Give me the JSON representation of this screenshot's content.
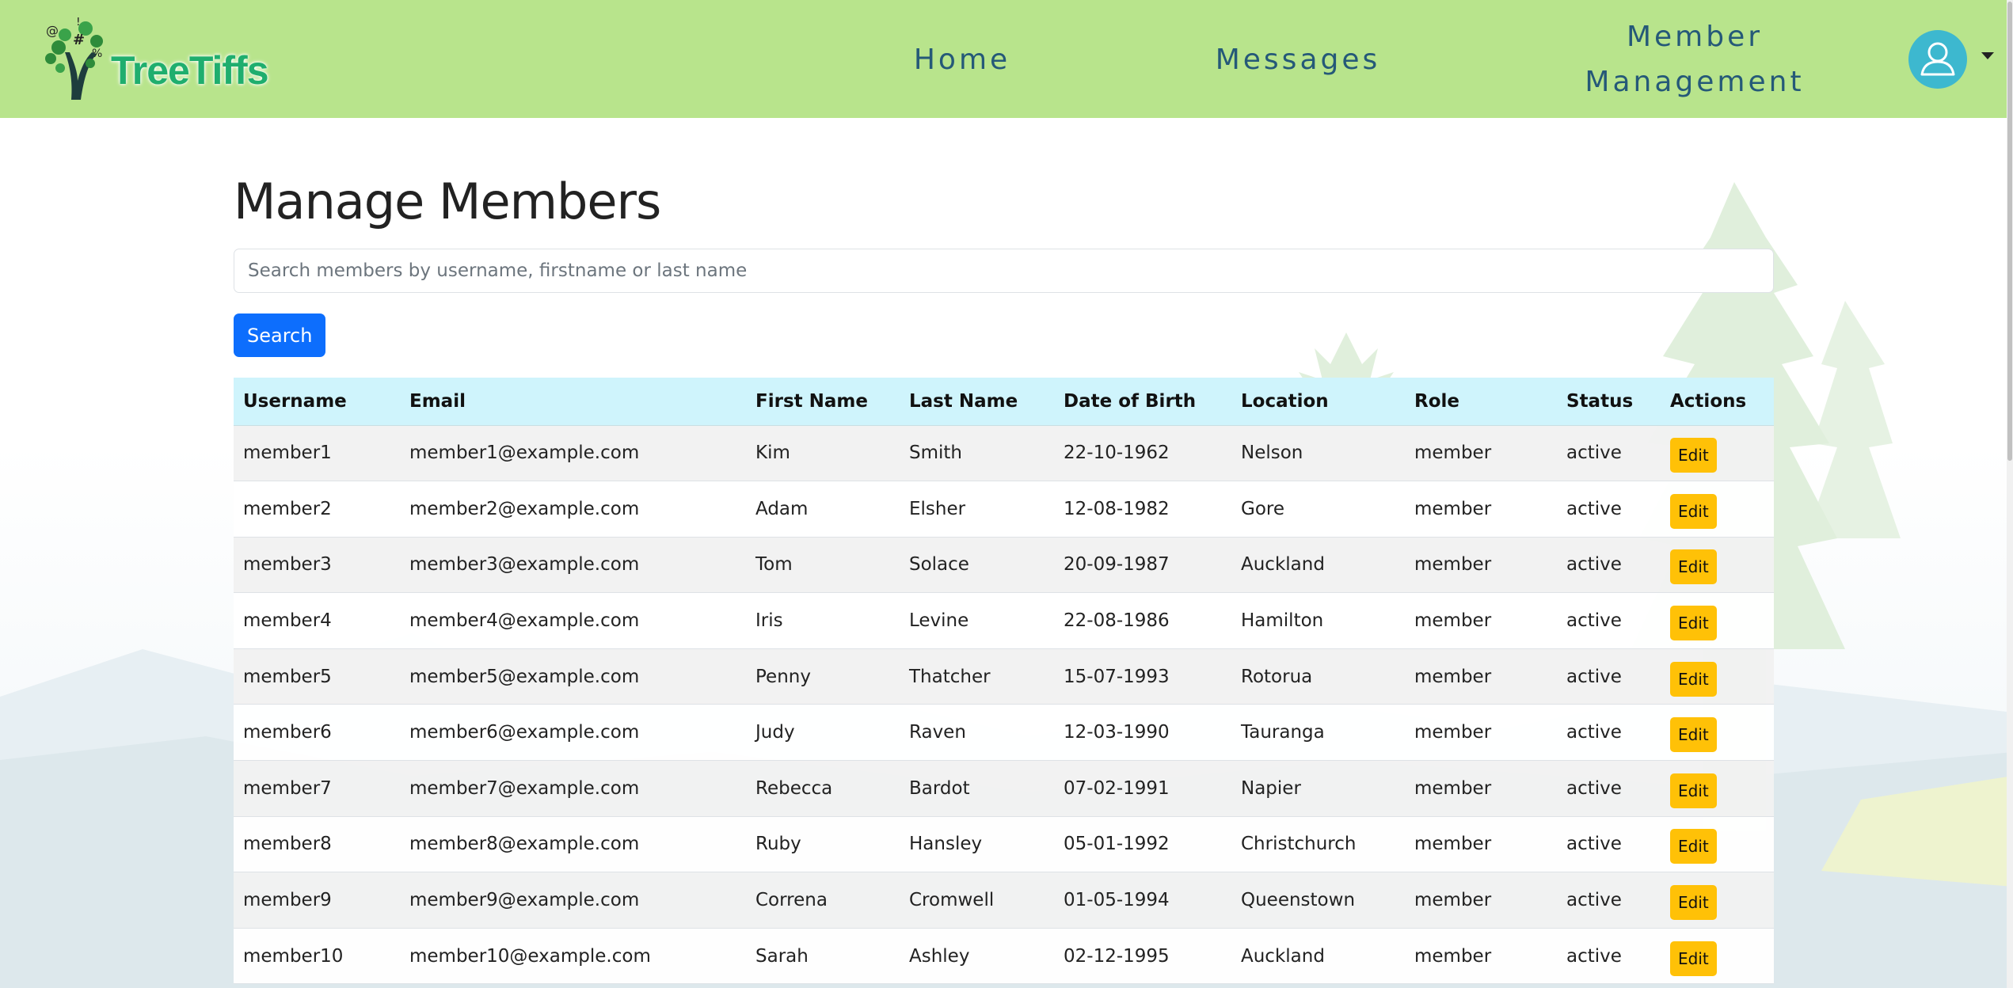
{
  "colors": {
    "navbar_bg": "#b8e48c",
    "nav_link": "#255978",
    "primary_button": "#0d6efd",
    "edit_button": "#ffc107",
    "table_header_bg": "#cff4fc",
    "avatar_bg": "#3db8cf"
  },
  "brand": {
    "name": "TreeTiffs",
    "logo_icon": "tree-logo-icon"
  },
  "nav": {
    "home": "Home",
    "messages": "Messages",
    "member_management_line1": "Member",
    "member_management_line2": "Management",
    "user_icon": "user-icon",
    "dropdown_icon": "caret-down-icon"
  },
  "page": {
    "title": "Manage Members",
    "search_placeholder": "Search members by username, firstname or last name",
    "search_value": "",
    "search_button": "Search"
  },
  "table": {
    "headers": [
      "Username",
      "Email",
      "First Name",
      "Last Name",
      "Date of Birth",
      "Location",
      "Role",
      "Status",
      "Actions"
    ],
    "edit_label": "Edit",
    "rows": [
      [
        "member1",
        "member1@example.com",
        "Kim",
        "Smith",
        "22-10-1962",
        "Nelson",
        "member",
        "active"
      ],
      [
        "member2",
        "member2@example.com",
        "Adam",
        "Elsher",
        "12-08-1982",
        "Gore",
        "member",
        "active"
      ],
      [
        "member3",
        "member3@example.com",
        "Tom",
        "Solace",
        "20-09-1987",
        "Auckland",
        "member",
        "active"
      ],
      [
        "member4",
        "member4@example.com",
        "Iris",
        "Levine",
        "22-08-1986",
        "Hamilton",
        "member",
        "active"
      ],
      [
        "member5",
        "member5@example.com",
        "Penny",
        "Thatcher",
        "15-07-1993",
        "Rotorua",
        "member",
        "active"
      ],
      [
        "member6",
        "member6@example.com",
        "Judy",
        "Raven",
        "12-03-1990",
        "Tauranga",
        "member",
        "active"
      ],
      [
        "member7",
        "member7@example.com",
        "Rebecca",
        "Bardot",
        "07-02-1991",
        "Napier",
        "member",
        "active"
      ],
      [
        "member8",
        "member8@example.com",
        "Ruby",
        "Hansley",
        "05-01-1992",
        "Christchurch",
        "member",
        "active"
      ],
      [
        "member9",
        "member9@example.com",
        "Correna",
        "Cromwell",
        "01-05-1994",
        "Queenstown",
        "member",
        "active"
      ],
      [
        "member10",
        "member10@example.com",
        "Sarah",
        "Ashley",
        "02-12-1995",
        "Auckland",
        "member",
        "active"
      ]
    ]
  }
}
